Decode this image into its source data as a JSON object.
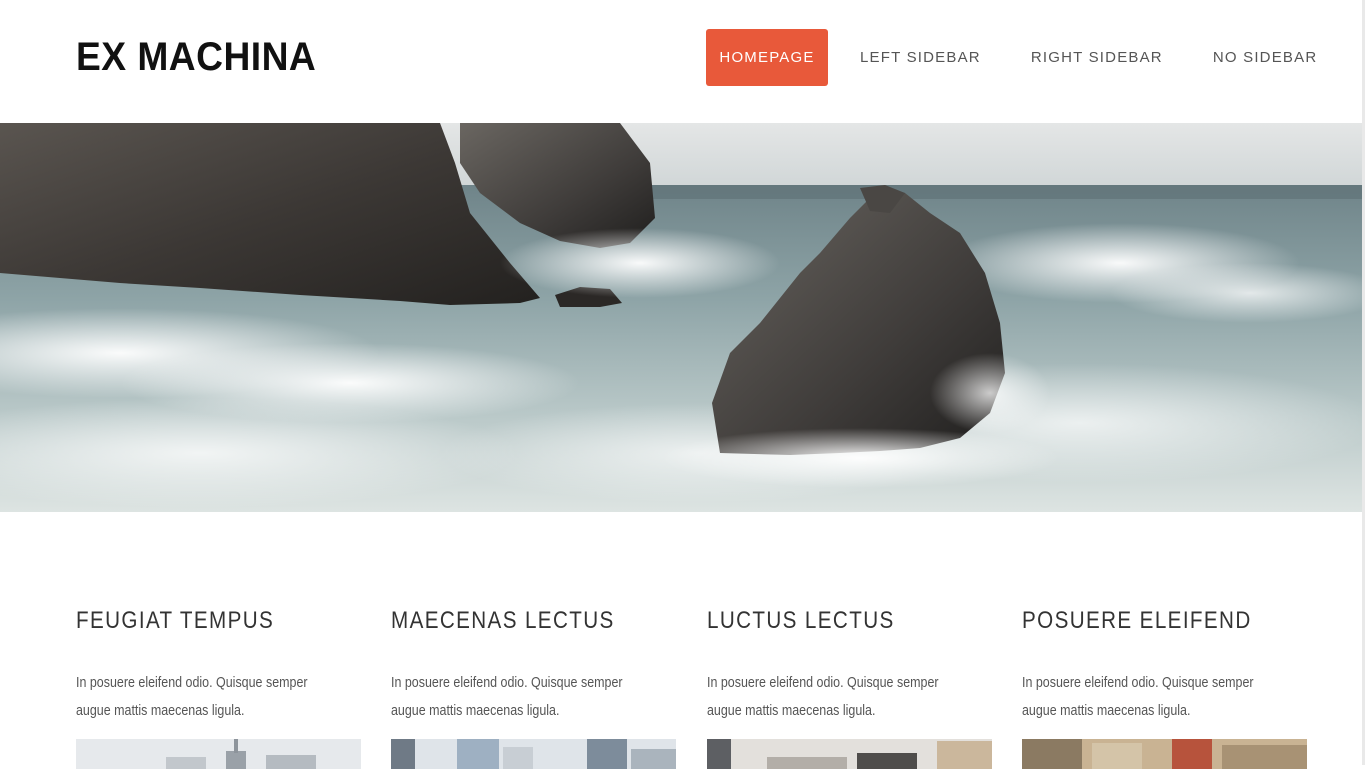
{
  "header": {
    "logo": "EX MACHINA",
    "nav": [
      {
        "label": "HOMEPAGE",
        "active": true
      },
      {
        "label": "LEFT SIDEBAR",
        "active": false
      },
      {
        "label": "RIGHT SIDEBAR",
        "active": false
      },
      {
        "label": "NO SIDEBAR",
        "active": false
      }
    ]
  },
  "colors": {
    "accent": "#e8593a",
    "text": "#333333"
  },
  "features": [
    {
      "title": "FEUGIAT TEMPUS",
      "text": "In posuere eleifend odio. Quisque semper augue mattis maecenas ligula."
    },
    {
      "title": "MAECENAS LECTUS",
      "text": "In posuere eleifend odio. Quisque semper augue mattis maecenas ligula."
    },
    {
      "title": "LUCTUS LECTUS",
      "text": "In posuere eleifend odio. Quisque semper augue mattis maecenas ligula."
    },
    {
      "title": "POSUERE ELEIFEND",
      "text": "In posuere eleifend odio. Quisque semper augue mattis maecenas ligula."
    }
  ]
}
